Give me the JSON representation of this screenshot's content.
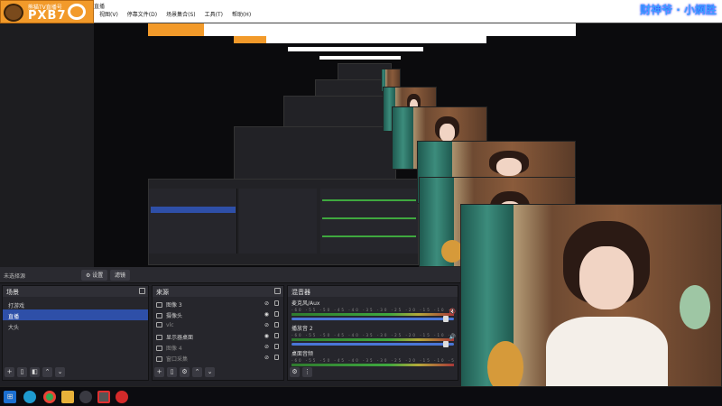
{
  "window": {
    "menu_title": "直播",
    "menus": [
      "视图(V)",
      "停靠文件(D)",
      "场景集合(S)",
      "工具(T)",
      "帮助(H)"
    ]
  },
  "logo": {
    "tagline": "熊猫TV直播号",
    "text": "PXB7"
  },
  "streamer_name": "财神爷 · 小婀胜",
  "top_strip": {
    "label": "未选择源",
    "properties_button": "⚙ 设置",
    "filters_button": "滤镜"
  },
  "scenes": {
    "title": "场景",
    "items": [
      "打游戏",
      "直播",
      "大头"
    ],
    "selected_index": 1
  },
  "sources": {
    "title": "来源",
    "items": [
      {
        "label": "图像 3",
        "visible": false
      },
      {
        "label": "摄像头",
        "visible": true
      },
      {
        "label": "vlc",
        "visible": false
      },
      {
        "label": "显示器桌面",
        "visible": true
      },
      {
        "label": "图像 4",
        "visible": false
      },
      {
        "label": "窗口采集",
        "visible": false
      }
    ]
  },
  "mixer": {
    "title": "混音器",
    "scale": "-60 -55 -50 -45 -40 -35 -30 -25 -20 -15 -10 -5 0",
    "channels": [
      {
        "name": "麦克风/Aux",
        "level": 0.96,
        "muted": true
      },
      {
        "name": "播放音 2",
        "level": 0.9,
        "muted": false
      },
      {
        "name": "桌面音频",
        "level": 0.93,
        "muted": false
      }
    ]
  },
  "taskbar": {
    "icons": [
      "windows-start",
      "edge",
      "chrome",
      "file-explorer",
      "obs",
      "record",
      "netease"
    ]
  },
  "colors": {
    "accent": "#2e4fa8",
    "logo_orange": "#f29a2a",
    "streamer_blue": "#3ea1ff"
  }
}
